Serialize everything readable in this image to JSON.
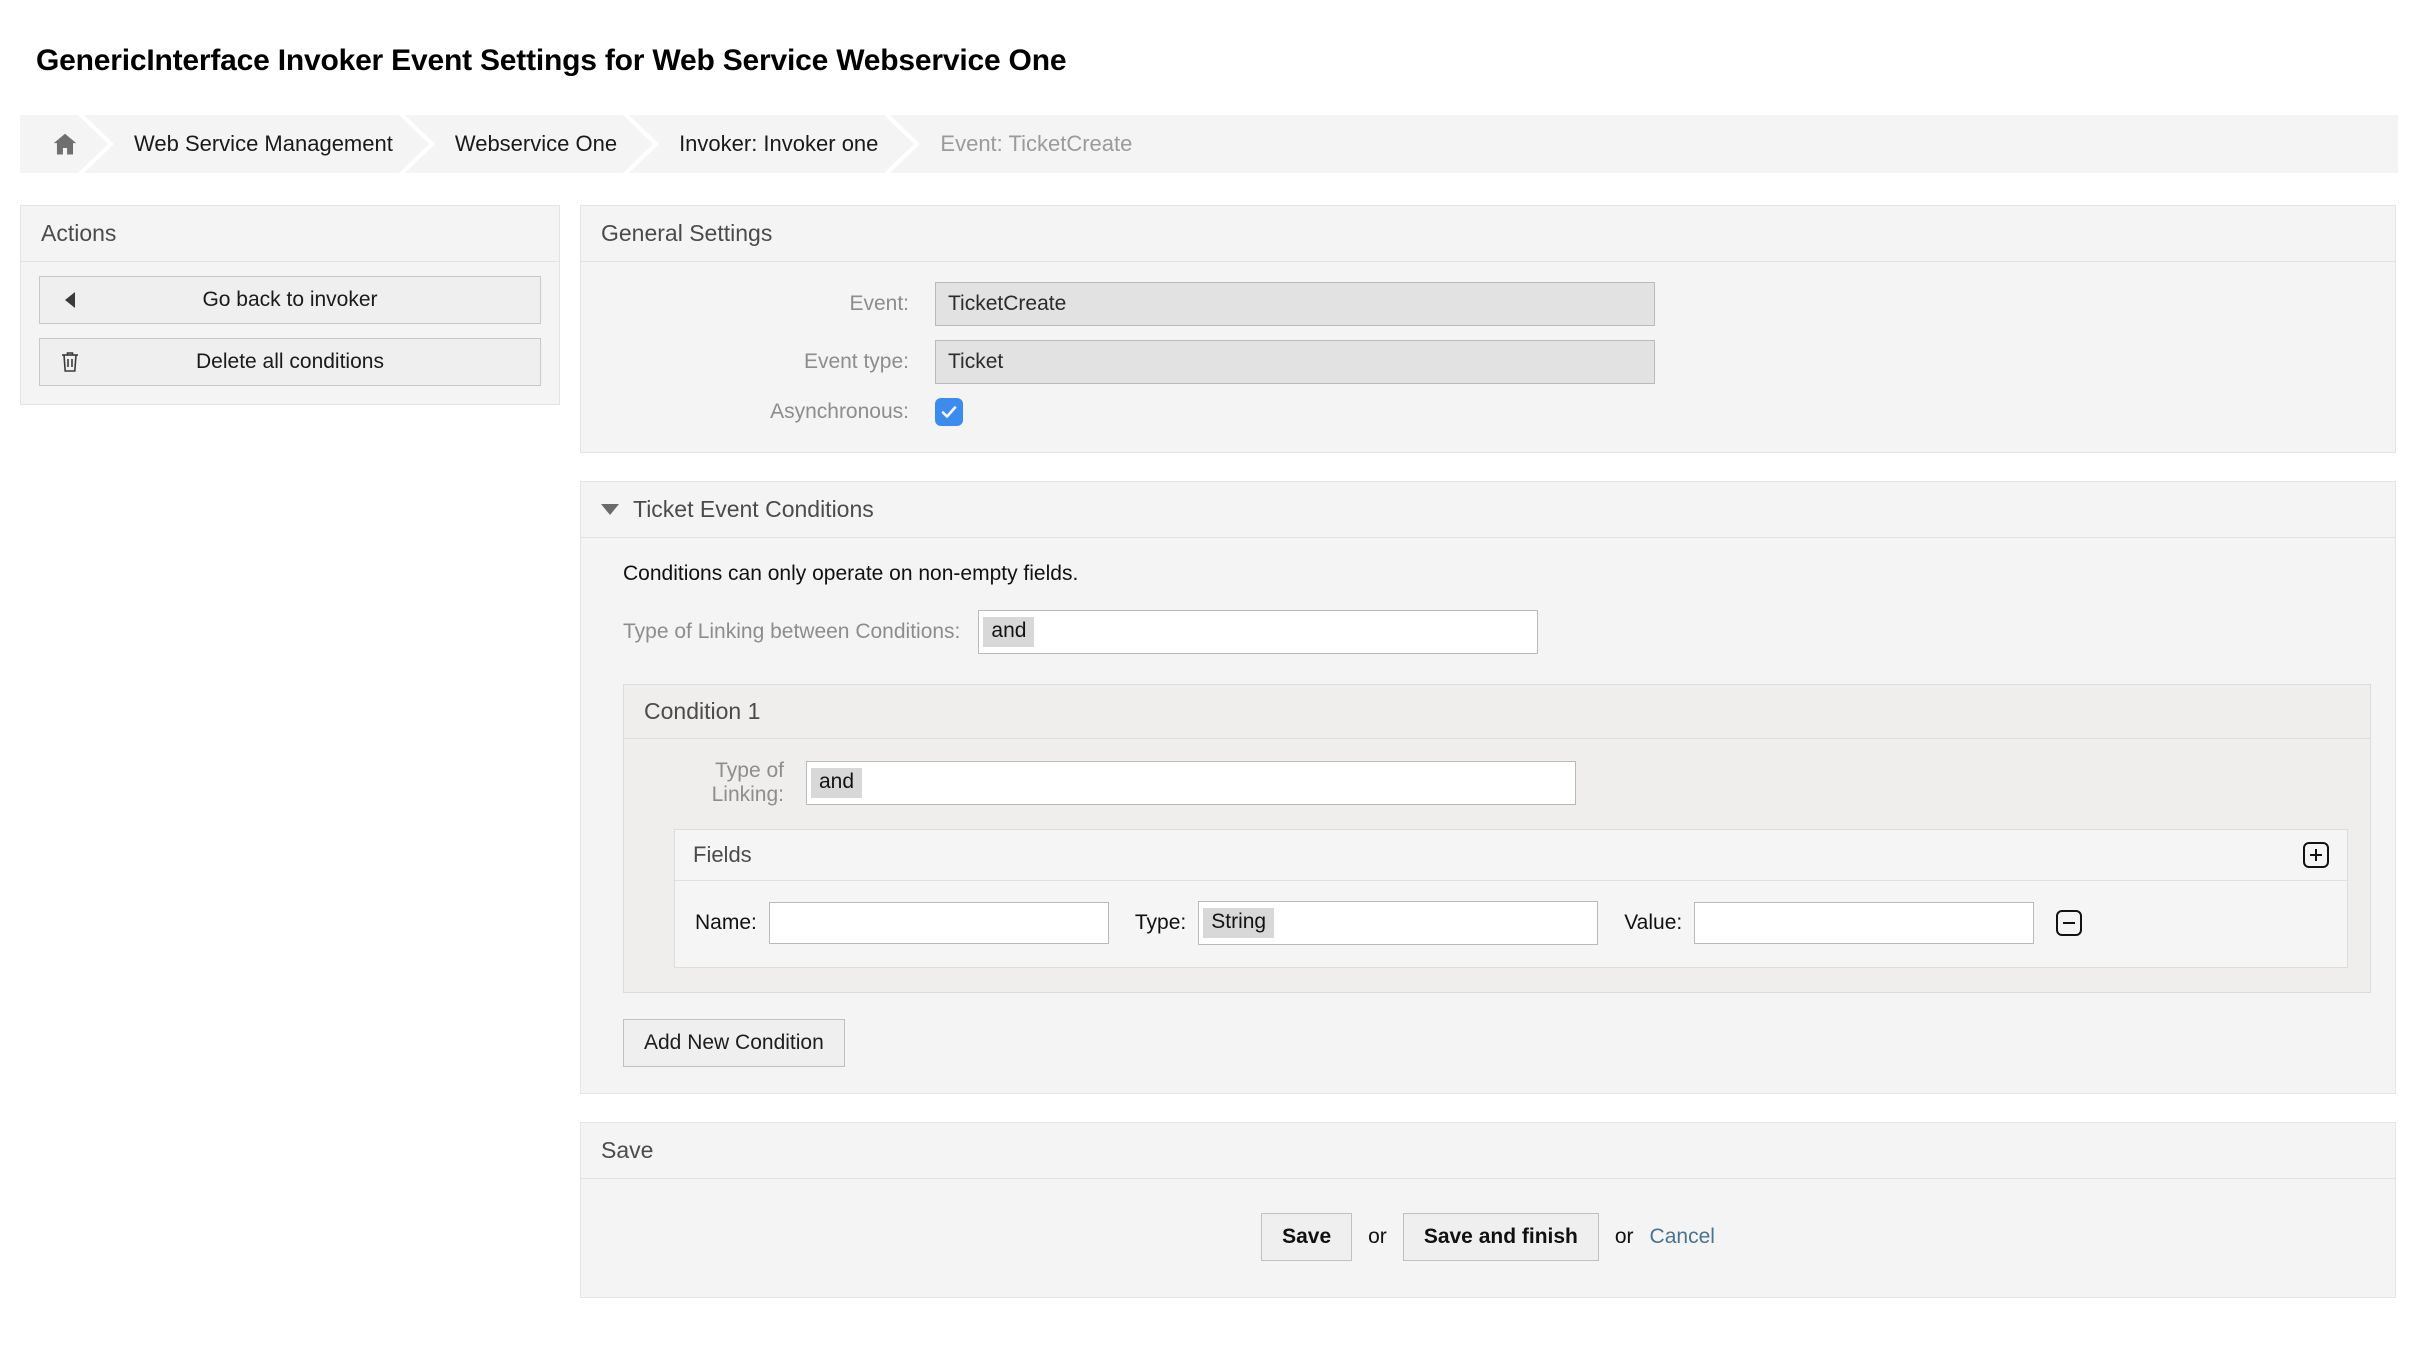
{
  "page": {
    "title": "GenericInterface Invoker Event Settings for Web Service Webservice One"
  },
  "breadcrumb": {
    "home_icon": "home-icon",
    "items": [
      {
        "label": "Web Service Management"
      },
      {
        "label": "Webservice One"
      },
      {
        "label": "Invoker: Invoker one"
      },
      {
        "label": "Event: TicketCreate"
      }
    ]
  },
  "sidebar": {
    "title": "Actions",
    "items": [
      {
        "label": "Go back to invoker",
        "icon": "caret-left-icon"
      },
      {
        "label": "Delete all conditions",
        "icon": "trash-icon"
      }
    ]
  },
  "general_settings": {
    "title": "General Settings",
    "event_label": "Event:",
    "event_value": "TicketCreate",
    "event_type_label": "Event type:",
    "event_type_value": "Ticket",
    "asynchronous_label": "Asynchronous:",
    "asynchronous_checked": "true"
  },
  "conditions": {
    "title": "Ticket Event Conditions",
    "collapse_icon": "triangle-down-icon",
    "note": "Conditions can only operate on non-empty fields.",
    "linking_label": "Type of Linking between Conditions:",
    "linking_value": "and",
    "condition": {
      "title": "Condition 1",
      "linking_label": "Type of Linking:",
      "linking_value": "and",
      "fields": {
        "title": "Fields",
        "add_icon": "plus-square-icon",
        "remove_icon": "minus-square-icon",
        "name_label": "Name:",
        "name_value": "",
        "type_label": "Type:",
        "type_value": "String",
        "value_label": "Value:",
        "value_value": ""
      }
    },
    "add_condition_label": "Add New Condition"
  },
  "save": {
    "title": "Save",
    "save_label": "Save",
    "or_label": "or",
    "save_finish_label": "Save and finish",
    "or_label_2": "or",
    "cancel_label": "Cancel"
  },
  "colors": {
    "checkbox_blue": "#3c8cf0",
    "link_blue": "#4a7391",
    "panel_bg": "#f4f4f4",
    "condition_bg": "#efeeec"
  }
}
